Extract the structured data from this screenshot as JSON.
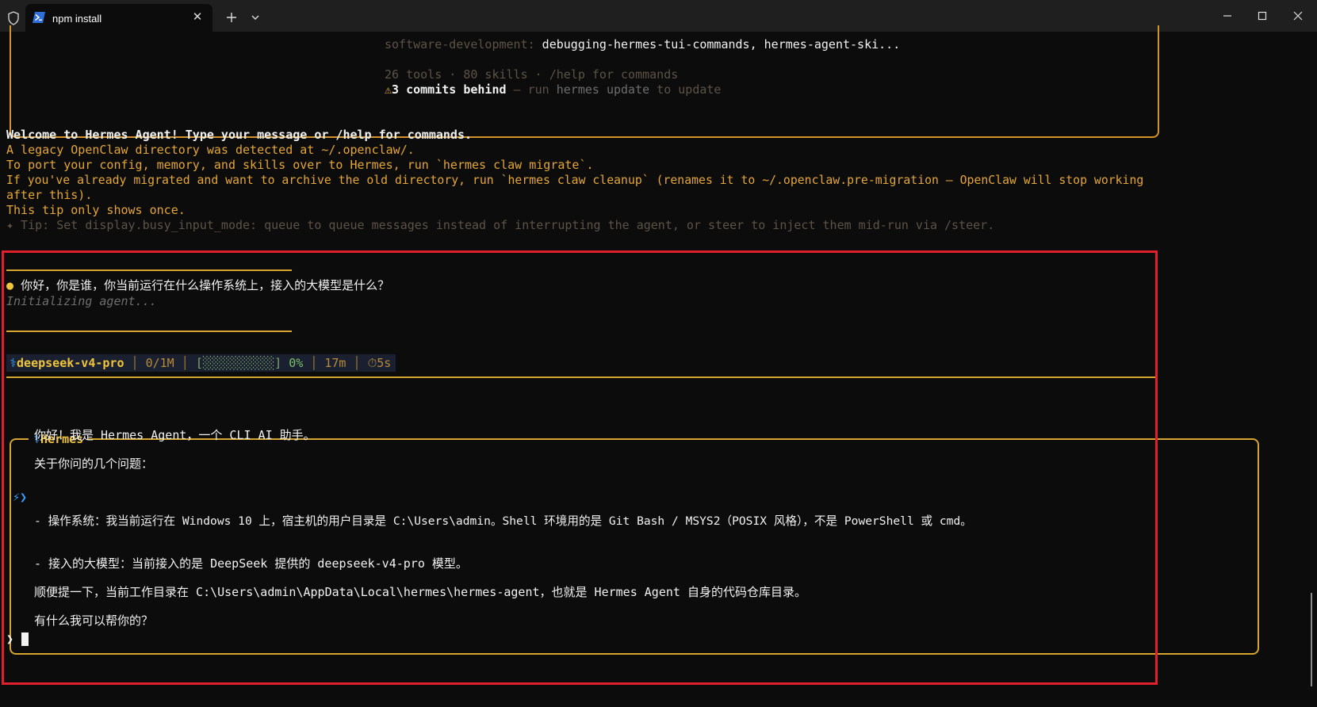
{
  "window": {
    "tab_title": "npm install",
    "close_tab_glyph": "✕"
  },
  "banner": {
    "skills_category": "software-development:",
    "skills_list": " debugging-hermes-tui-commands, hermes-agent-ski...",
    "tools_count": "26 tools",
    "skills_count": "80 skills",
    "help_hint": "/help for commands",
    "warn_icon": "⚠",
    "commits_behind": "3 commits behind",
    "run_text": " — run ",
    "update_cmd": "hermes update",
    "to_update": " to update"
  },
  "welcome": {
    "line1": "Welcome to Hermes Agent! Type your message or /help for commands.",
    "line2": "A legacy OpenClaw directory was detected at ~/.openclaw/.",
    "line3": "To port your config, memory, and skills over to Hermes, run `hermes claw migrate`.",
    "line4": "If you've already migrated and want to archive the old directory, run `hermes claw cleanup` (renames it to ~/.openclaw.pre-migration — OpenClaw will stop working",
    "line5": "after this).",
    "line6": "This tip only shows once.",
    "tip": "✦ Tip: Set display.busy_input_mode: queue to queue messages instead of interrupting the agent, or steer to inject them mid-run via /steer."
  },
  "user_message": {
    "bullet": "●",
    "text": "你好，你是谁，你当前运行在什么操作系统上，接入的大模型是什么？",
    "status": "Initializing agent..."
  },
  "status_bar": {
    "model_icon": "⚕",
    "model": "deepseek-v4-pro",
    "tokens": "0/1M",
    "context_bar": "[░░░░░░░░░░]",
    "context_pct": "0%",
    "context_fraction": 0.0,
    "elapsed": "17m",
    "timer_icon": "⏱",
    "timer": "5s",
    "sep": "│"
  },
  "response": {
    "label_icon": "⚕",
    "label": "Hermes",
    "agent_icon": "⚡❯",
    "p1": "你好！我是 Hermes Agent，一个 CLI AI 助手。",
    "p2": "关于你问的几个问题：",
    "p3": "- 操作系统：我当前运行在 Windows 10 上，宿主机的用户目录是 C:\\Users\\admin。Shell 环境用的是 Git Bash / MSYS2（POSIX 风格），不是 PowerShell 或 cmd。",
    "p4": "- 接入的大模型：当前接入的是 DeepSeek 提供的 deepseek-v4-pro 模型。",
    "p5": "顺便提一下，当前工作目录在 C:\\Users\\admin\\AppData\\Local\\hermes\\hermes-agent，也就是 Hermes Agent 自身的代码仓库目录。",
    "p6": "有什么我可以帮你的？"
  },
  "input": {
    "prompt": "❯"
  },
  "colors": {
    "accent_orange": "#e4a636",
    "accent_gold": "#f0c43c",
    "highlight_red": "#e0202c",
    "background": "#0c0c0c"
  }
}
